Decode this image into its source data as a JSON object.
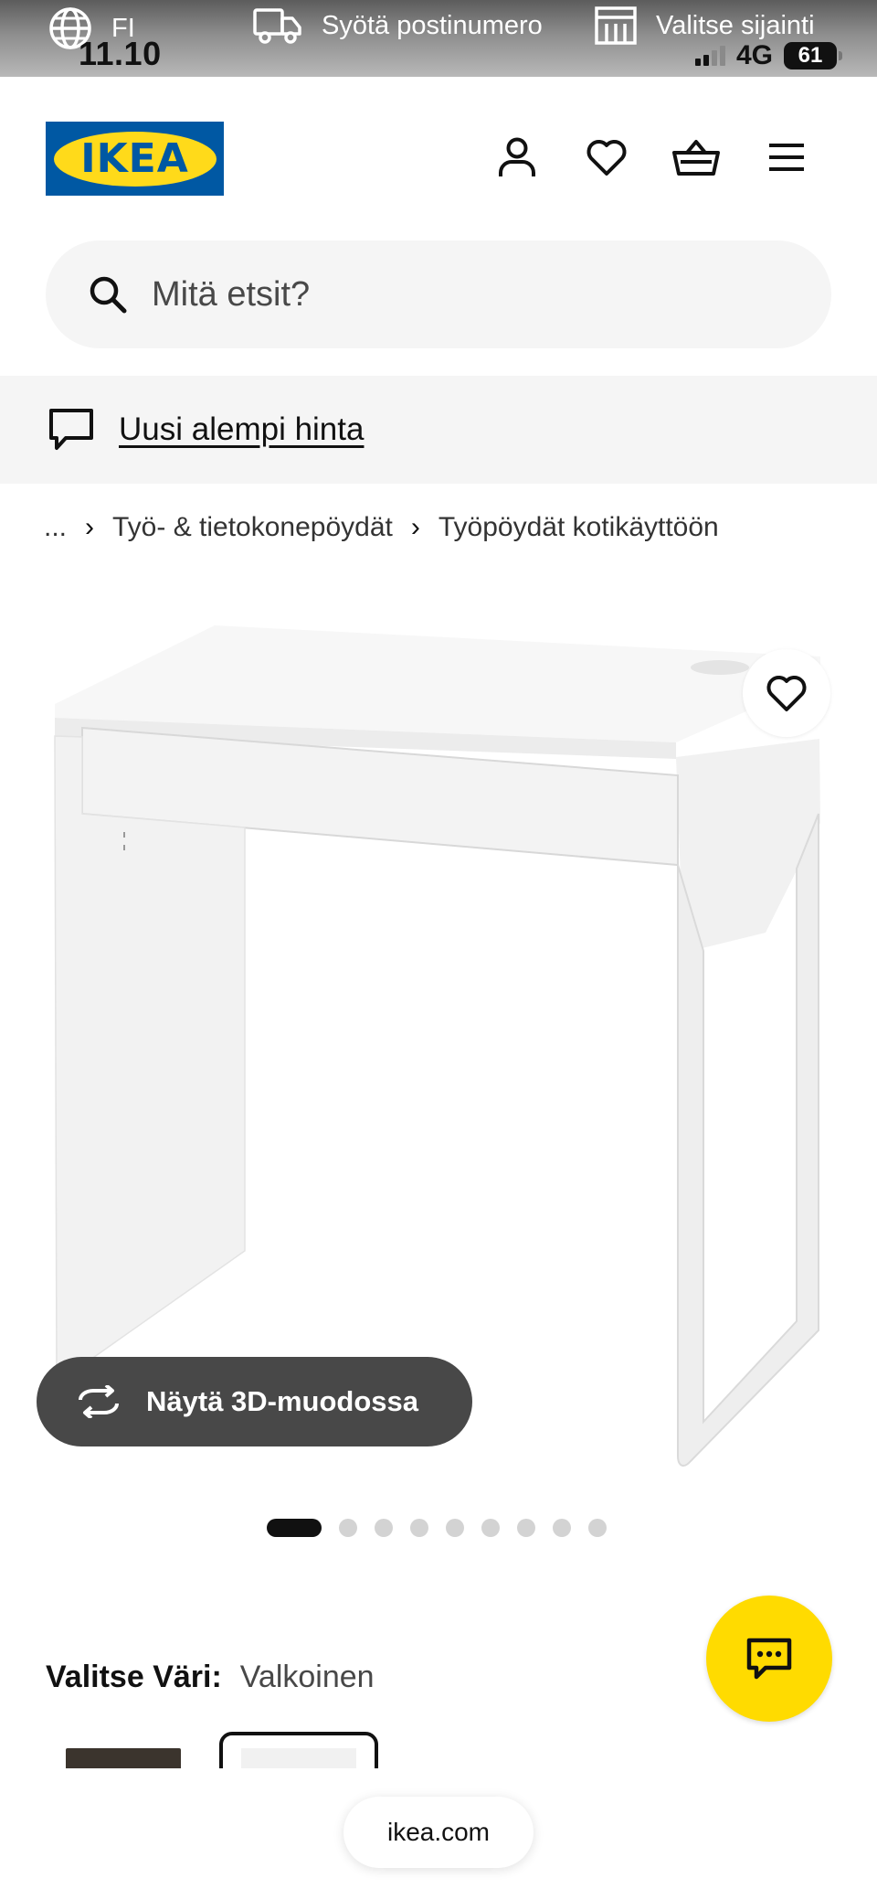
{
  "status_bar": {
    "language": "FI",
    "time": "11.10",
    "postcode_label": "Syötä postinumero",
    "location_label": "Valitse sijainti",
    "network": "4G",
    "battery": "61"
  },
  "header": {
    "logo_text": "IKEA",
    "icons": [
      "account-icon",
      "heart-icon",
      "basket-icon",
      "menu-icon"
    ]
  },
  "search": {
    "placeholder": "Mitä etsit?"
  },
  "banner": {
    "link_text": "Uusi alempi hinta"
  },
  "breadcrumb": {
    "ellipsis": "...",
    "items": [
      "Työ- & tietokonepöydät",
      "Työpöydät kotikäyttöön"
    ]
  },
  "product_image": {
    "view_3d_label": "Näytä 3D-muodossa",
    "slide_count": 9,
    "active_slide": 1
  },
  "color_chooser": {
    "label": "Valitse Väri:",
    "selected": "Valkoinen"
  },
  "browser": {
    "url": "ikea.com"
  },
  "colors": {
    "ikea_blue": "#0058a3",
    "ikea_yellow": "#ffda1a",
    "chat_yellow": "#ffdb00",
    "dark_button": "#484848",
    "light_grey": "#f5f5f5"
  }
}
